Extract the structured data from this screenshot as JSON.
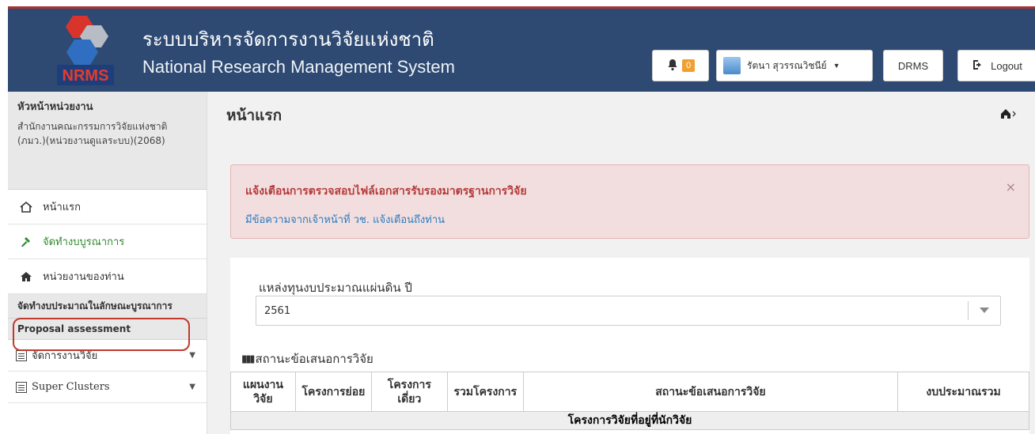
{
  "header": {
    "title_th": "ระบบบริหารจัดการงานวิจัยแห่งชาติ",
    "title_en": "National Research Management System",
    "logo_text": "NRMS",
    "notification_count": "0",
    "user_name": "รัตนา สุวรรณวิชนีย์",
    "drms_label": "DRMS",
    "logout_label": "Logout"
  },
  "sidebar": {
    "role_title": "หัวหน้าหน่วยงาน",
    "role_org": "สำนักงานคณะกรรมการวิจัยแห่งชาติ (ภมว.)(หน่วยงานดูแลระบบ)(2068)",
    "items": [
      {
        "label": "หน้าแรก",
        "icon": "home-icon"
      },
      {
        "label": "จัดทำงบบูรณาการ",
        "icon": "gavel-icon"
      },
      {
        "label": "หน่วยงานของท่าน",
        "icon": "building-icon"
      }
    ],
    "section_budget": "จัดทำงบประมาณในลักษณะบูรณาการ",
    "section_assessment": "Proposal assessment",
    "dropdowns": [
      {
        "label": "จัดการงานวิจัย",
        "icon": "list-icon"
      },
      {
        "label": "Super Clusters",
        "icon": "list-icon"
      }
    ]
  },
  "main": {
    "page_title": "หน้าแรก",
    "alert_title": "แจ้งเตือนการตรวจสอบไฟล์เอกสารรับรองมาตรฐานการวิจัย",
    "alert_link": "มีข้อความจากเจ้าหน้าที่ วช. แจ้งเตือนถึงท่าน",
    "alert_close": "×",
    "fund_label": "แหล่งทุนงบประมาณแผ่นดิน ปี",
    "fund_year": "2561",
    "status_title": "สถานะข้อเสนอการวิจัย",
    "table_headers": [
      "แผนงานวิจัย",
      "โครงการย่อย",
      "โครงการเดี่ยว",
      "รวมโครงการ",
      "สถานะข้อเสนอการวิจัย",
      "งบประมาณรวม"
    ],
    "group_row": "โครงการวิจัยที่อยู่ที่นักวิจัย"
  }
}
